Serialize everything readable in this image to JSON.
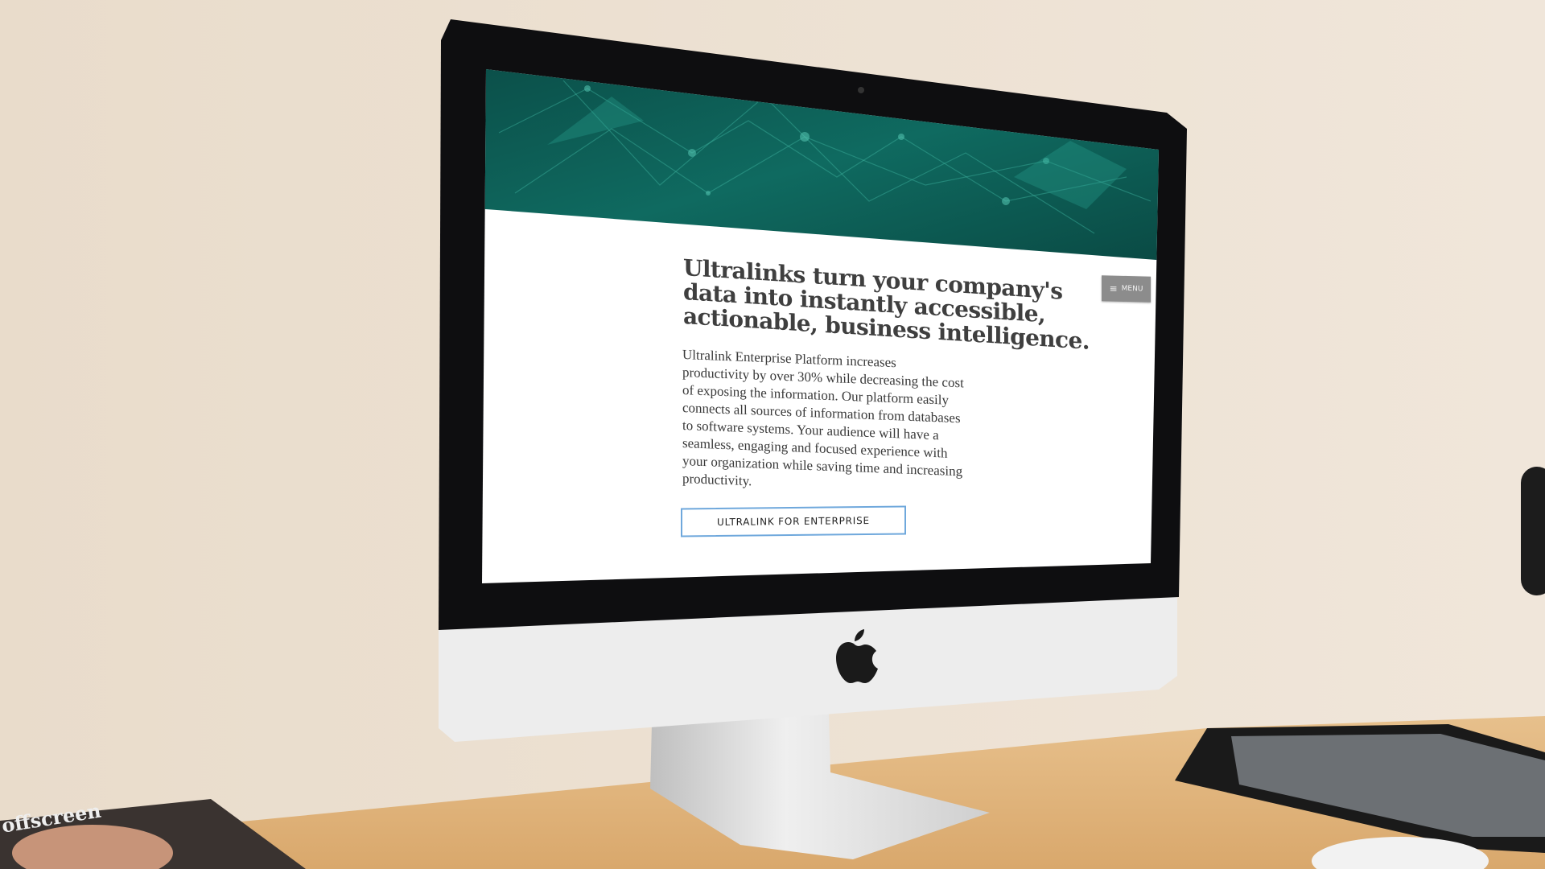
{
  "website": {
    "menu_label": "MENU",
    "headline_lines": [
      "Ultralinks turn your company's",
      "data into instantly accessible,",
      "actionable, business intelligence."
    ],
    "body_lines": [
      "Ultralink Enterprise Platform increases",
      "productivity by over 30% while decreasing the cost",
      "of exposing the information. Our platform easily",
      "connects all sources of information from databases",
      "to software systems. Your audience will have a",
      "seamless, engaging and focused experience with",
      "your organization while saving time and increasing",
      "productivity."
    ],
    "cta_label": "ULTRALINK FOR ENTERPRISE",
    "banner_color": "#0d5a52",
    "cta_border_color": "#6fa8dc"
  },
  "scene": {
    "magazine_title": "offscreen",
    "icons": [
      "apple-logo-icon",
      "menu-hamburger-icon"
    ]
  }
}
